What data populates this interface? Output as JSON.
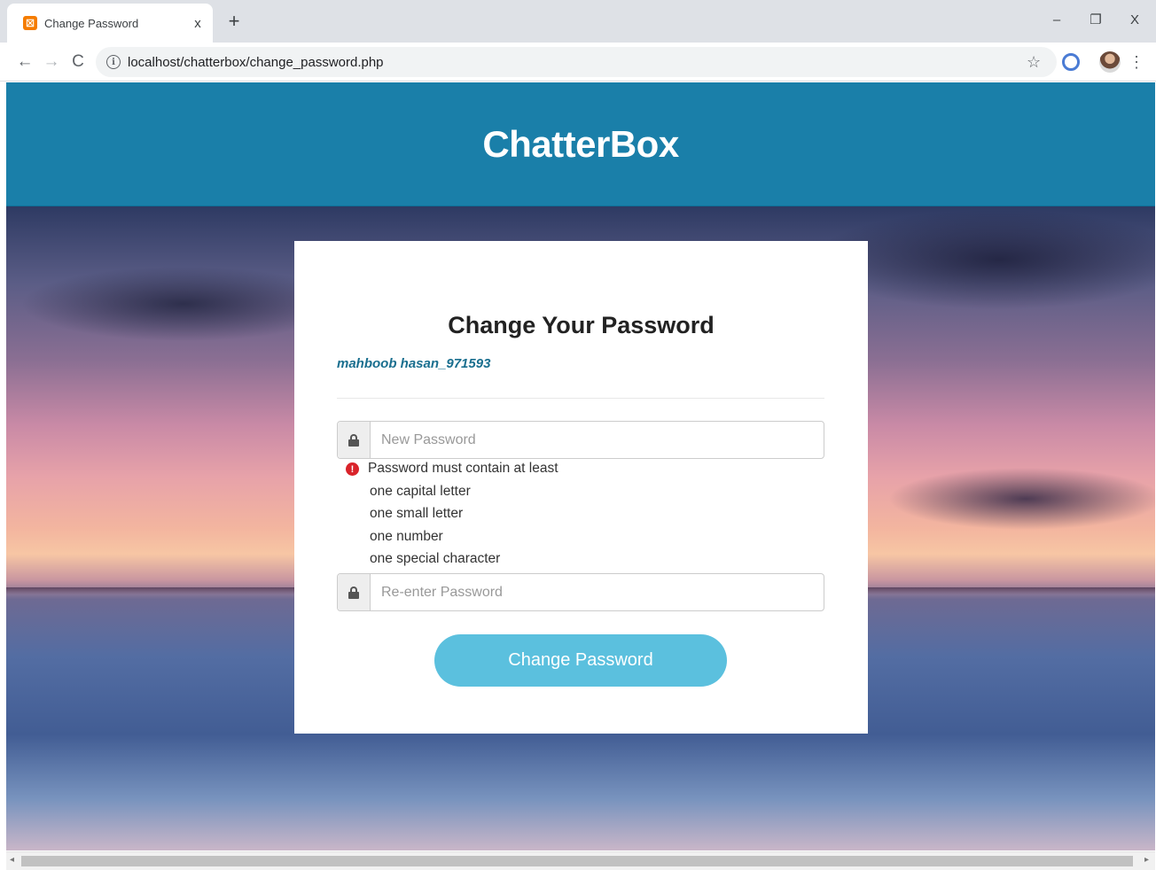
{
  "browser": {
    "tab_title": "Change Password",
    "tab_close": "x",
    "new_tab": "+",
    "favicon_glyph": "☒",
    "url": "localhost/chatterbox/change_password.php",
    "nav": {
      "back": "←",
      "forward": "→",
      "reload": "C"
    },
    "window": {
      "minimize": "–",
      "restore": "❐",
      "close": "X"
    },
    "star": "☆",
    "menu": "⋮"
  },
  "header": {
    "brand": "ChatterBox"
  },
  "form": {
    "title": "Change Your Password",
    "username": "mahboob hasan_971593",
    "new_password_placeholder": "New Password",
    "reenter_password_placeholder": "Re-enter Password",
    "submit_label": "Change Password",
    "warn_glyph": "!",
    "rules": {
      "intro": "Password must contain at least",
      "items": [
        "one capital letter",
        "one small letter",
        "one number",
        "one special character"
      ]
    }
  },
  "colors": {
    "header_bg": "#1a7fa9",
    "username": "#1a6f8f",
    "button_bg": "#5bc0de",
    "warning": "#d9232a"
  },
  "icons": [
    "favicon-icon",
    "back-icon",
    "forward-icon",
    "reload-icon",
    "info-icon",
    "star-icon",
    "extension-icon",
    "avatar",
    "menu-icon",
    "lock-icon",
    "warning-icon"
  ]
}
